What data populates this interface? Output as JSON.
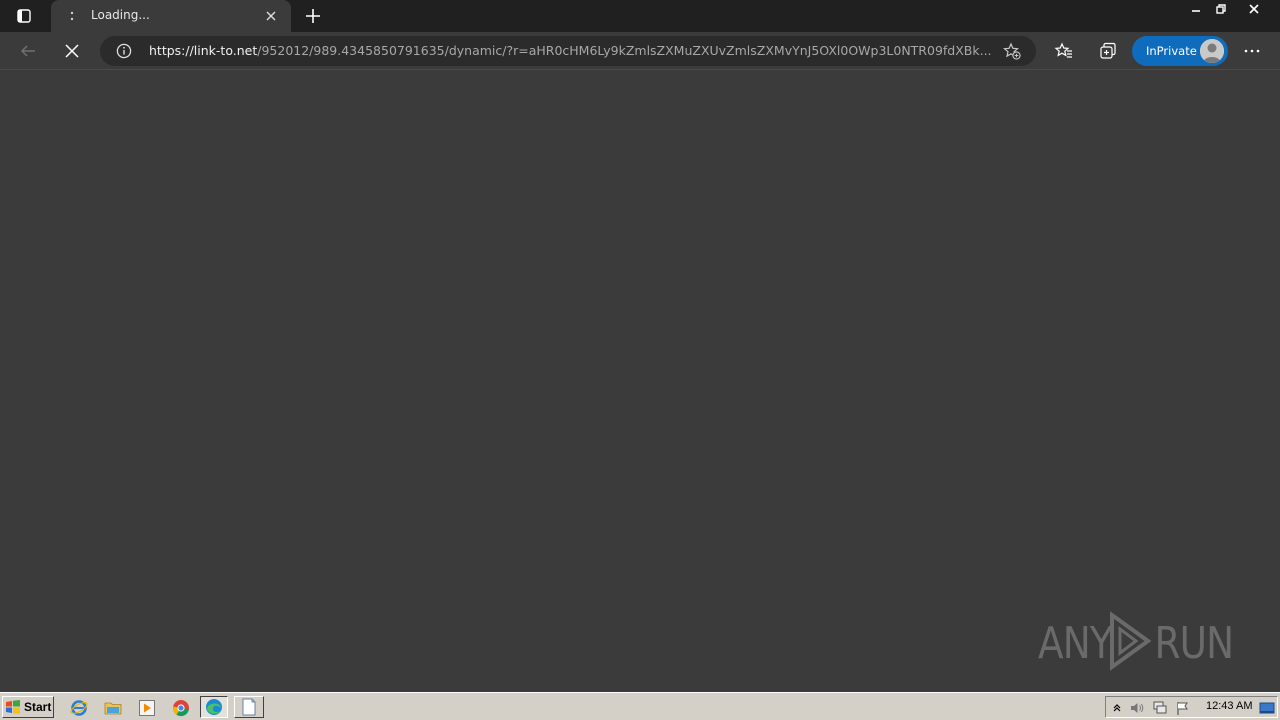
{
  "tab": {
    "title": "Loading...",
    "close_icon": "close-icon",
    "favicon": "loading-spinner-icon"
  },
  "toolbar": {
    "url_host": "https://link-to.net",
    "url_rest": "/952012/989.4345850791635/dynamic/?r=aHR0cHM6Ly9kZmlsZXMuZXUvZmlsZXMvYnJ5OXl0OWp3L0NTR09fdXBk...",
    "inprivate_label": "InPrivate"
  },
  "watermark": {
    "text": "ANY RUN"
  },
  "taskbar": {
    "start_label": "Start",
    "clock": "12:43 AM"
  },
  "colors": {
    "content_bg": "#3b3b3b",
    "tabstrip_bg": "#202020",
    "inprivate_accent": "#0f6cbd",
    "taskbar_bg": "#d4d0c8"
  }
}
